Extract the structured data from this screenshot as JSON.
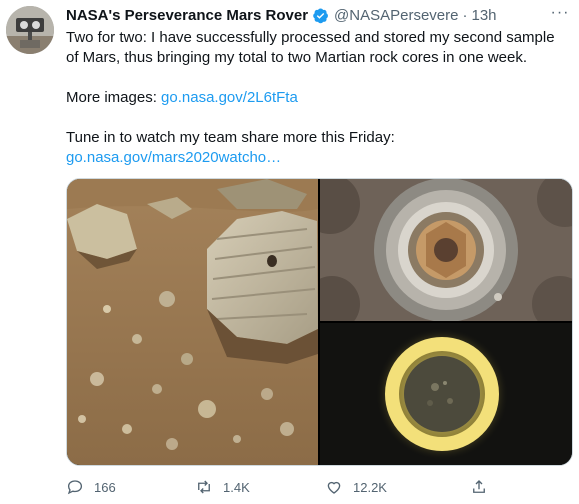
{
  "author": {
    "name": "NASA's Perseverance Mars Rover",
    "handle": "@NASAPersevere",
    "separator": "·",
    "time": "13h"
  },
  "menu": {
    "more_label": "···"
  },
  "tweet": {
    "line1": "Two for two: I have successfully processed and stored my second sample of Mars, thus bringing my total to two Martian rock cores in one week.",
    "more_images_label": "More images: ",
    "more_images_link": "go.nasa.gov/2L6tFta",
    "tune_in": "Tune in to watch my team share more this Friday:",
    "watch_link": "go.nasa.gov/mars2020watcho…"
  },
  "actions": {
    "replies": "166",
    "retweets": "1.4K",
    "likes": "12.2K"
  },
  "colors": {
    "link": "#1d9bf0",
    "verified": "#1d9bf0",
    "muted": "#536471"
  },
  "icons": [
    "verified-badge-icon",
    "more-icon",
    "reply-icon",
    "retweet-icon",
    "like-icon",
    "share-icon"
  ]
}
